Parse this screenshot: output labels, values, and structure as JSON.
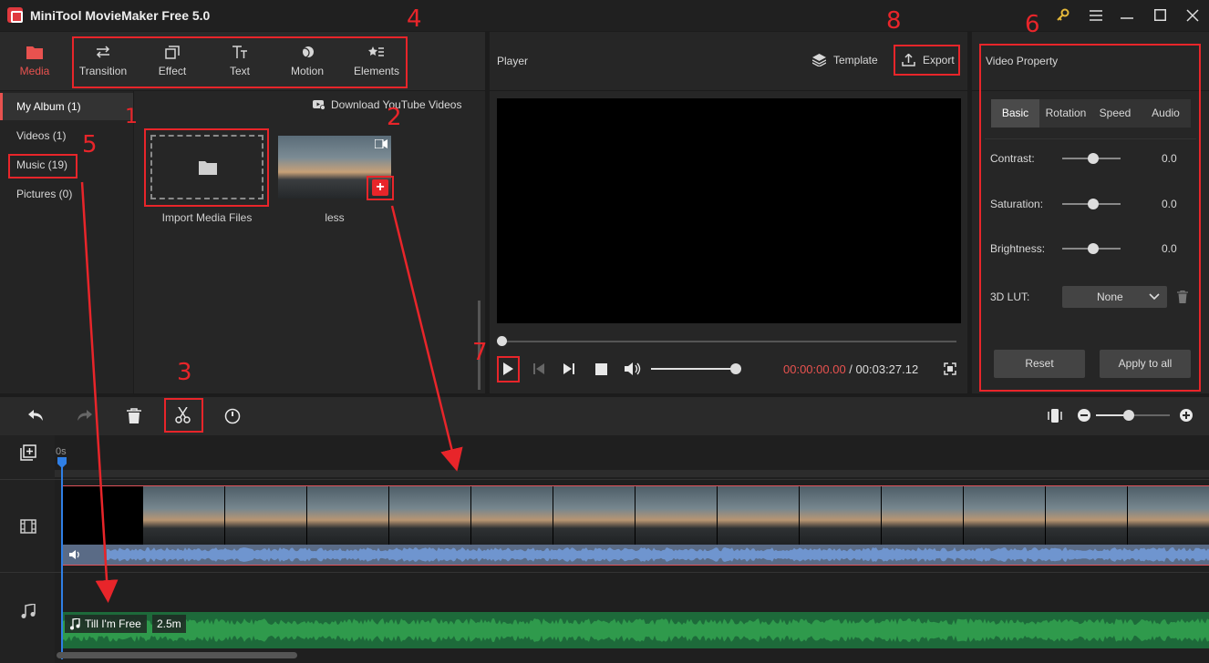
{
  "app": {
    "title": "MiniTool MovieMaker Free 5.0"
  },
  "toolbar": {
    "tabs": [
      {
        "label": "Media"
      },
      {
        "label": "Transition"
      },
      {
        "label": "Effect"
      },
      {
        "label": "Text"
      },
      {
        "label": "Motion"
      },
      {
        "label": "Elements"
      }
    ]
  },
  "sidebar": {
    "items": [
      {
        "label": "My Album (1)"
      },
      {
        "label": "Videos (1)"
      },
      {
        "label": "Music (19)"
      },
      {
        "label": "Pictures (0)"
      }
    ]
  },
  "media": {
    "download_label": "Download YouTube Videos",
    "import_label": "Import Media Files",
    "clip_name": "less"
  },
  "player": {
    "title": "Player",
    "template_label": "Template",
    "export_label": "Export",
    "time_current": "00:00:00.00",
    "time_sep": " / ",
    "time_total": "00:03:27.12",
    "volume": 1.0,
    "progress": 0.0
  },
  "video_property": {
    "title": "Video Property",
    "tabs": [
      "Basic",
      "Rotation",
      "Speed",
      "Audio"
    ],
    "contrast_label": "Contrast:",
    "contrast_value": "0.0",
    "saturation_label": "Saturation:",
    "saturation_value": "0.0",
    "brightness_label": "Brightness:",
    "brightness_value": "0.0",
    "lut_label": "3D LUT:",
    "lut_value": "None",
    "reset_label": "Reset",
    "apply_label": "Apply to all"
  },
  "timeline": {
    "ruler_start": "0s",
    "music_clip_name": "Till I'm Free",
    "music_clip_duration": "2.5m"
  },
  "annotations": [
    "1",
    "2",
    "3",
    "4",
    "5",
    "6",
    "7",
    "8"
  ],
  "colors": {
    "accent": "#e8524f",
    "annotation": "#e8252a",
    "audio_wave": "#6f95cf",
    "music_wave": "#2f9a4c"
  }
}
